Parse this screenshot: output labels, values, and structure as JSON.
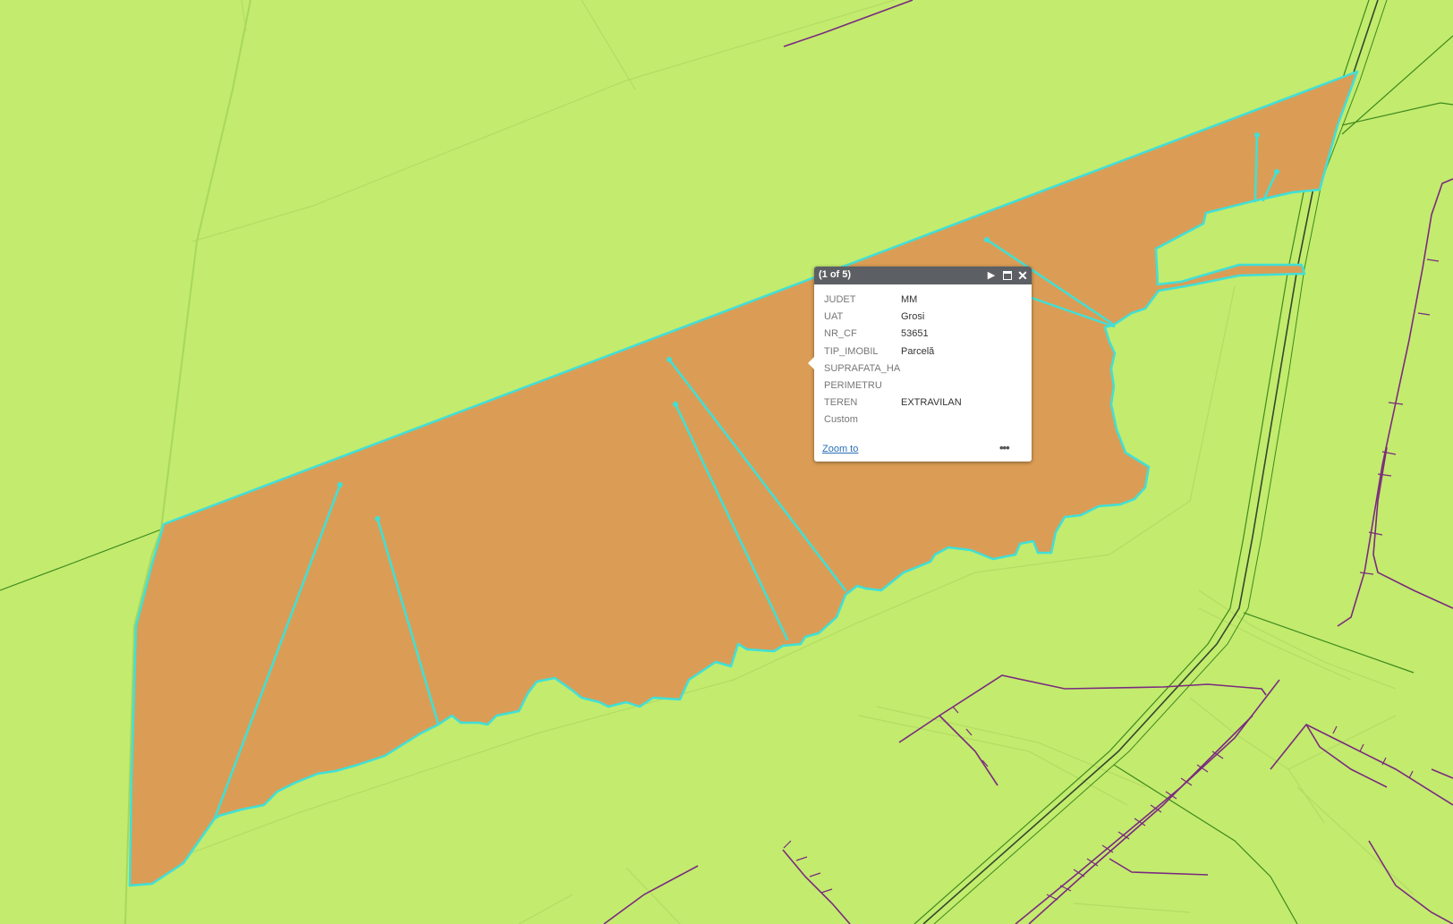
{
  "colors": {
    "background": "#c3eb6e",
    "parcel_fill": "#db9d55",
    "parcel_outline": "#3fe0d8",
    "power_lines": "#7a2a7e",
    "roads": "#3d8a1c",
    "popup_titlebar": "#5c5f63"
  },
  "popup": {
    "counter": "(1 of 5)",
    "next_icon": "next-arrow-icon",
    "maximize_icon": "maximize-icon",
    "close_icon": "close-icon",
    "attributes": [
      {
        "key": "JUDET",
        "value": "MM"
      },
      {
        "key": "UAT",
        "value": "Grosi"
      },
      {
        "key": "NR_CF",
        "value": "53651"
      },
      {
        "key": "TIP_IMOBIL",
        "value": "Parcelă"
      },
      {
        "key": "SUPRAFATA_HA",
        "value": ""
      },
      {
        "key": "PERIMETRU",
        "value": ""
      },
      {
        "key": "TEREN",
        "value": "EXTRAVILAN"
      },
      {
        "key": "Custom",
        "value": ""
      }
    ],
    "zoom_label": "Zoom to",
    "more_label": "•••"
  }
}
